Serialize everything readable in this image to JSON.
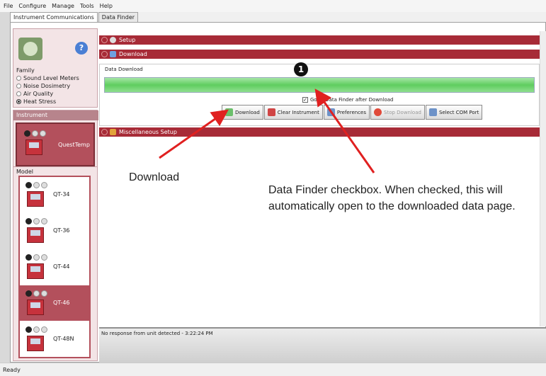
{
  "menu": [
    "File",
    "Configure",
    "Manage",
    "Tools",
    "Help"
  ],
  "tabs": [
    "Instrument Communications",
    "Data Finder"
  ],
  "left": {
    "family_label": "Family",
    "families": [
      {
        "label": "Sound Level Meters",
        "selected": false
      },
      {
        "label": "Noise Dosimetry",
        "selected": false
      },
      {
        "label": "Air Quality",
        "selected": false
      },
      {
        "label": "Heat Stress",
        "selected": true
      }
    ],
    "instrument_label": "Instrument",
    "instrument_name": "QuestTemp",
    "model_label": "Model",
    "models": [
      {
        "label": "QT-34",
        "selected": false
      },
      {
        "label": "QT-36",
        "selected": false
      },
      {
        "label": "QT-44",
        "selected": false
      },
      {
        "label": "QT-46",
        "selected": true
      },
      {
        "label": "QT-48N",
        "selected": false
      }
    ]
  },
  "main": {
    "setup_label": "Setup",
    "download_label": "Download",
    "data_download_label": "Data Download",
    "progress": 1.0,
    "checkbox_label": "Go to Data Finder after Download",
    "checkbox_checked": true,
    "buttons": {
      "download": "Download",
      "clear": "Clear Instrument",
      "preferences": "Preferences",
      "stop": "Stop Download",
      "com": "Select COM Port"
    },
    "misc_label": "Miscellaneous Setup",
    "status_message": "No response from unit detected - 3:22:24 PM"
  },
  "status_bar": "Ready",
  "annotations": {
    "marker": "1",
    "download_callout": "Download",
    "finder_callout": "Data Finder checkbox. When checked, this will automatically open to the downloaded data page."
  },
  "colors": {
    "accent": "#a72b37",
    "selected": "#b3505c",
    "progress": "#5fcd5f"
  }
}
